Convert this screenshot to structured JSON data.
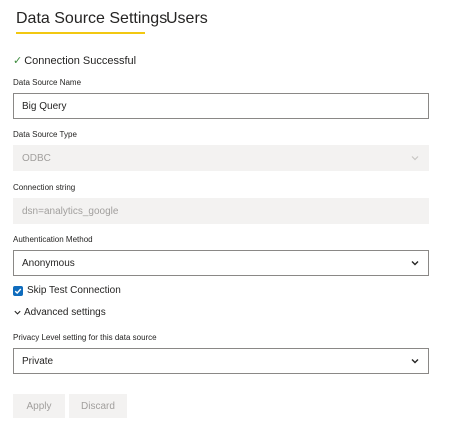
{
  "tabs": {
    "settings_label": "Data Source Settings",
    "users_label": "Users"
  },
  "status": {
    "text": "Connection Successful"
  },
  "data_source_name": {
    "label": "Data Source Name",
    "value": "Big Query"
  },
  "data_source_type": {
    "label": "Data Source Type",
    "value": "ODBC"
  },
  "connection_string": {
    "label": "Connection string",
    "value": "dsn=analytics_google"
  },
  "authentication": {
    "label": "Authentication Method",
    "value": "Anonymous"
  },
  "skip_test": {
    "label": "Skip Test Connection",
    "checked": true
  },
  "advanced": {
    "label": "Advanced settings"
  },
  "privacy": {
    "label": "Privacy Level setting for this data source",
    "value": "Private"
  },
  "buttons": {
    "apply_label": "Apply",
    "discard_label": "Discard"
  },
  "colors": {
    "accent_underline": "#f2c811",
    "check_green": "#3c8a3c",
    "checkbox_blue": "#0f6cbd",
    "disabled_bg": "#f3f2f1"
  },
  "icons": {
    "status": "checkmark-icon",
    "dropdown": "chevron-down-icon",
    "advanced": "chevron-down-icon"
  }
}
